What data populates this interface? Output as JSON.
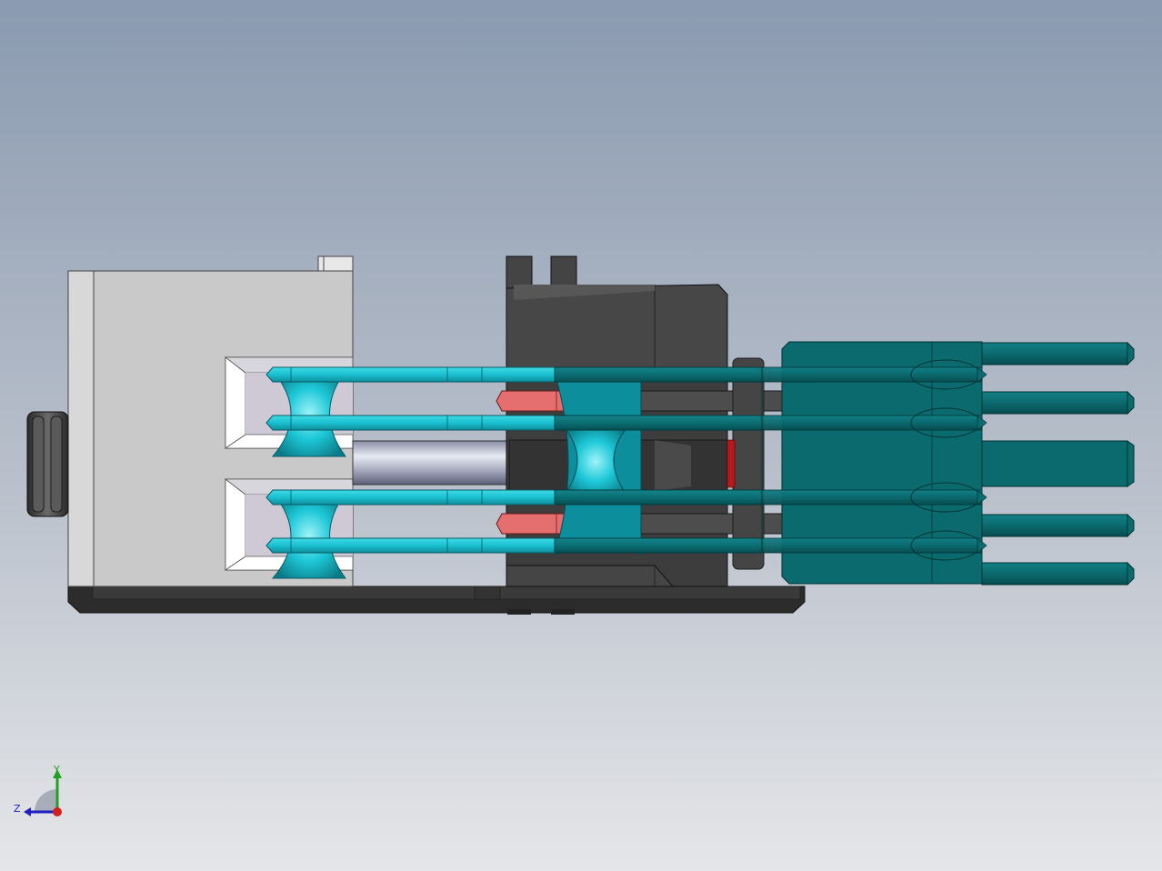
{
  "viewport": {
    "background_top": "#8a9ab0",
    "background_bottom": "#e3e5e8",
    "colors": {
      "housing_gray": "#c8c8c8",
      "dark_part": "#3e3e3e",
      "cyan_tube": "#1ec8d8",
      "teal_part": "#0b6a6e",
      "salmon_part": "#e07070",
      "rod_steel": "#c8cad6"
    }
  },
  "triad": {
    "x_color": "#2020c0",
    "y_color": "#20a020",
    "z_color": "#d02020",
    "y_label": "Y",
    "z_label": "Z",
    "x_icon": "x-axis-arrow-icon",
    "y_icon": "y-axis-arrow-icon",
    "origin_icon": "origin-dot-icon"
  }
}
